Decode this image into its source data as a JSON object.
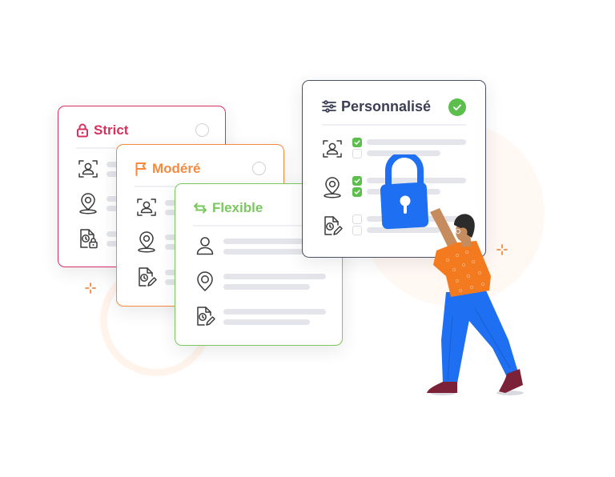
{
  "illustration": {
    "description": "Privacy level selection cards with a person holding a padlock",
    "colors": {
      "strict": "#d6315f",
      "modere": "#f58a3f",
      "flexible": "#79c95e",
      "personnalise": "#4a4f63",
      "check_green": "#5cbf4d",
      "lock_blue": "#1f6ff2",
      "background_peach": "#fff8f3"
    }
  },
  "cards": [
    {
      "id": "strict",
      "title": "Strict",
      "icon": "lock-icon",
      "selected": false,
      "rows": [
        {
          "icon": "face-scan-icon"
        },
        {
          "icon": "location-pin-icon"
        },
        {
          "icon": "document-clock-lock-icon"
        }
      ]
    },
    {
      "id": "modere",
      "title": "Modéré",
      "icon": "flag-icon",
      "selected": false,
      "rows": [
        {
          "icon": "face-scan-icon"
        },
        {
          "icon": "location-pin-icon"
        },
        {
          "icon": "document-clock-edit-icon"
        }
      ]
    },
    {
      "id": "flexible",
      "title": "Flexible",
      "icon": "arrows-left-right-icon",
      "selected": false,
      "rows": [
        {
          "icon": "user-icon"
        },
        {
          "icon": "location-pin-icon"
        },
        {
          "icon": "document-clock-edit-icon"
        }
      ]
    },
    {
      "id": "personnalise",
      "title": "Personnalisé",
      "icon": "sliders-icon",
      "selected": true,
      "rows": [
        {
          "icon": "face-scan-icon",
          "checks": [
            true,
            false
          ]
        },
        {
          "icon": "location-pin-icon",
          "checks": [
            true,
            true
          ]
        },
        {
          "icon": "document-clock-edit-icon",
          "checks": [
            false,
            false
          ]
        }
      ]
    }
  ]
}
